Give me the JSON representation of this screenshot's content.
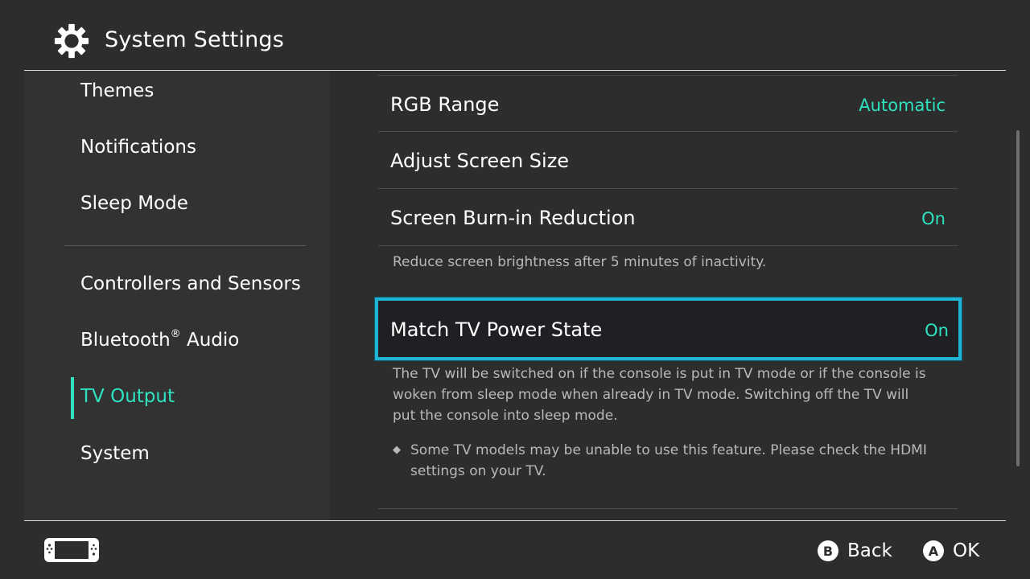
{
  "header": {
    "title": "System Settings",
    "icon": "gear-icon"
  },
  "sidebar": {
    "items": [
      {
        "label": "Themes"
      },
      {
        "label": "Notifications"
      },
      {
        "label": "Sleep Mode"
      },
      {
        "label": "Controllers and Sensors"
      },
      {
        "label": "Bluetooth",
        "sup": "®",
        "suffix": " Audio"
      },
      {
        "label": "TV Output",
        "active": true
      },
      {
        "label": "System"
      }
    ]
  },
  "main": {
    "rows": [
      {
        "label": "RGB Range",
        "value": "Automatic"
      },
      {
        "label": "Adjust Screen Size",
        "value": ""
      },
      {
        "label": "Screen Burn-in Reduction",
        "value": "On",
        "description": "Reduce screen brightness after 5 minutes of inactivity."
      },
      {
        "label": "Match TV Power State",
        "value": "On",
        "selected": true,
        "description_lines": [
          "The TV will be switched on if the console is put in TV mode or if the console is",
          "woken from sleep mode when already in TV mode. Switching off the TV will",
          "put the console into sleep mode."
        ],
        "note_bullet": "◆",
        "note_lines": [
          "Some TV models may be unable to use this feature. Please check the HDMI",
          "settings on your TV."
        ]
      }
    ]
  },
  "footer": {
    "console_icon": "console-icon",
    "back": {
      "button": "B",
      "label": "Back"
    },
    "ok": {
      "button": "A",
      "label": "OK"
    }
  },
  "colors": {
    "background": "#2d2d2d",
    "accent": "#2fe2c0",
    "selection_border": "#1fb4d4"
  }
}
